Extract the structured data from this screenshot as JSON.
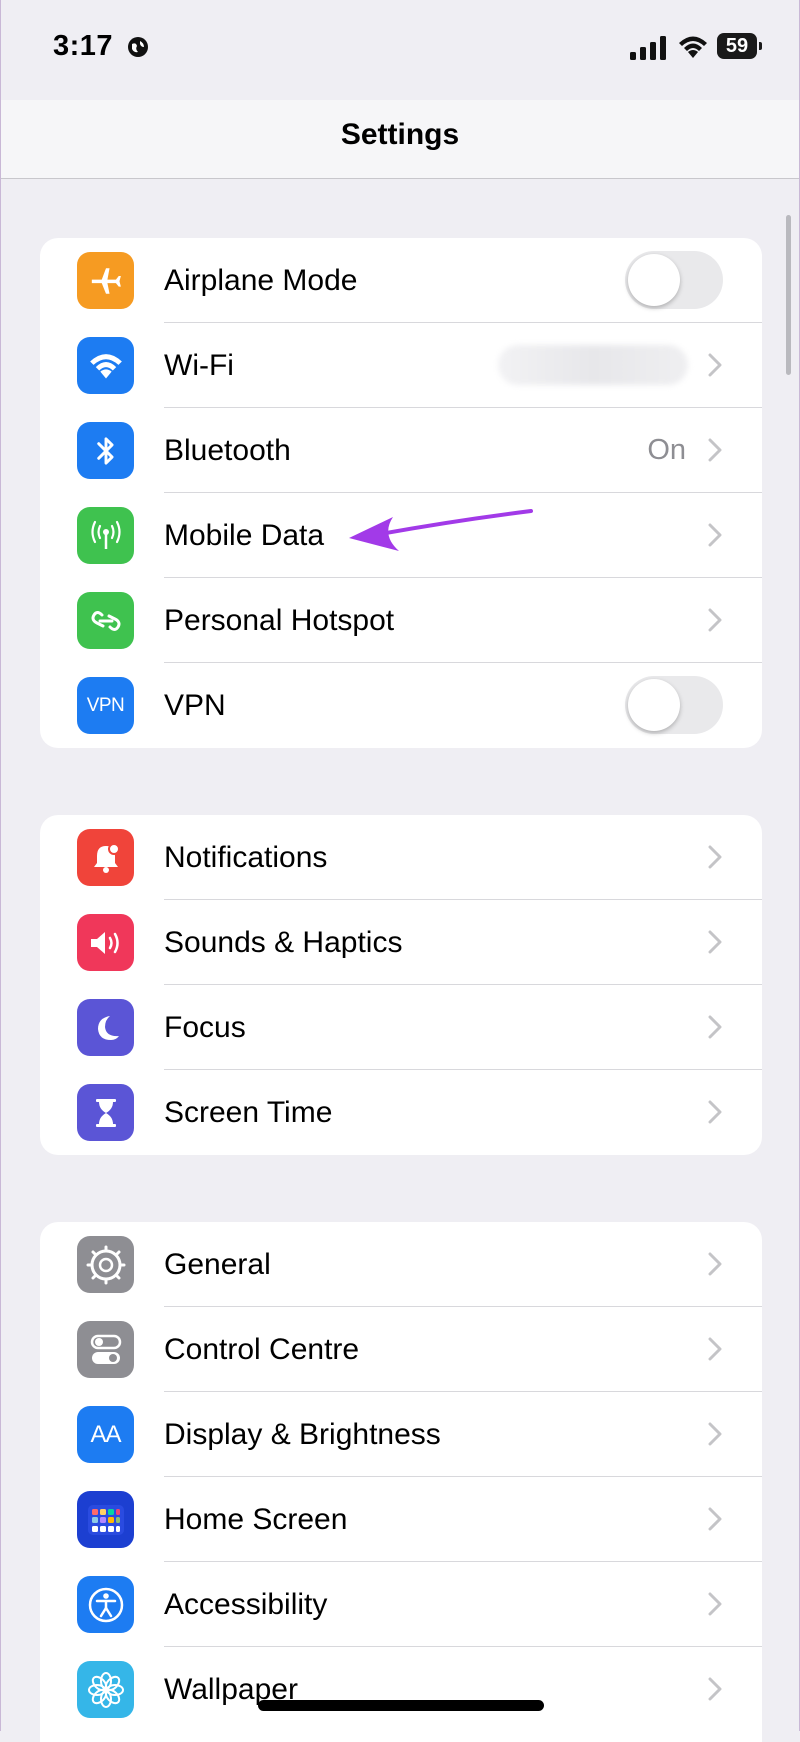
{
  "status": {
    "time": "3:17",
    "battery": "59"
  },
  "nav": {
    "title": "Settings"
  },
  "groups": [
    {
      "items": [
        {
          "label": "Airplane Mode",
          "icon": "airplane-icon",
          "color": "#f69b22",
          "control": "toggle",
          "toggle_on": false
        },
        {
          "label": "Wi-Fi",
          "icon": "wifi-icon",
          "color": "#1d7cf2",
          "control": "chevron"
        },
        {
          "label": "Bluetooth",
          "icon": "bluetooth-icon",
          "color": "#1d7cf2",
          "control": "chevron",
          "value": "On"
        },
        {
          "label": "Mobile Data",
          "icon": "antenna-icon",
          "color": "#3fc24f",
          "control": "chevron"
        },
        {
          "label": "Personal Hotspot",
          "icon": "hotspot-icon",
          "color": "#3fc24f",
          "control": "chevron"
        },
        {
          "label": "VPN",
          "icon": "vpn-icon",
          "icon_text": "VPN",
          "color": "#1d7cf2",
          "control": "toggle",
          "toggle_on": false
        }
      ]
    },
    {
      "items": [
        {
          "label": "Notifications",
          "icon": "bell-icon",
          "color": "#f0443a",
          "control": "chevron"
        },
        {
          "label": "Sounds & Haptics",
          "icon": "speaker-icon",
          "color": "#f0375a",
          "control": "chevron"
        },
        {
          "label": "Focus",
          "icon": "moon-icon",
          "color": "#5b55d6",
          "control": "chevron"
        },
        {
          "label": "Screen Time",
          "icon": "hourglass-icon",
          "color": "#5b55d6",
          "control": "chevron"
        }
      ]
    },
    {
      "items": [
        {
          "label": "General",
          "icon": "gear-icon",
          "color": "#8e8e93",
          "control": "chevron"
        },
        {
          "label": "Control Centre",
          "icon": "switches-icon",
          "color": "#8e8e93",
          "control": "chevron"
        },
        {
          "label": "Display & Brightness",
          "icon": "text-size-icon",
          "icon_text": "AA",
          "color": "#1d7cf2",
          "control": "chevron"
        },
        {
          "label": "Home Screen",
          "icon": "app-grid-icon",
          "color": "#1c3fd1",
          "control": "chevron"
        },
        {
          "label": "Accessibility",
          "icon": "accessibility-icon",
          "color": "#1d7cf2",
          "control": "chevron"
        },
        {
          "label": "Wallpaper",
          "icon": "flower-icon",
          "color": "#35b6e8",
          "control": "chevron"
        }
      ]
    }
  ],
  "annotation": {
    "icon": "pointer-arrow-icon",
    "color": "#a23ae8"
  }
}
